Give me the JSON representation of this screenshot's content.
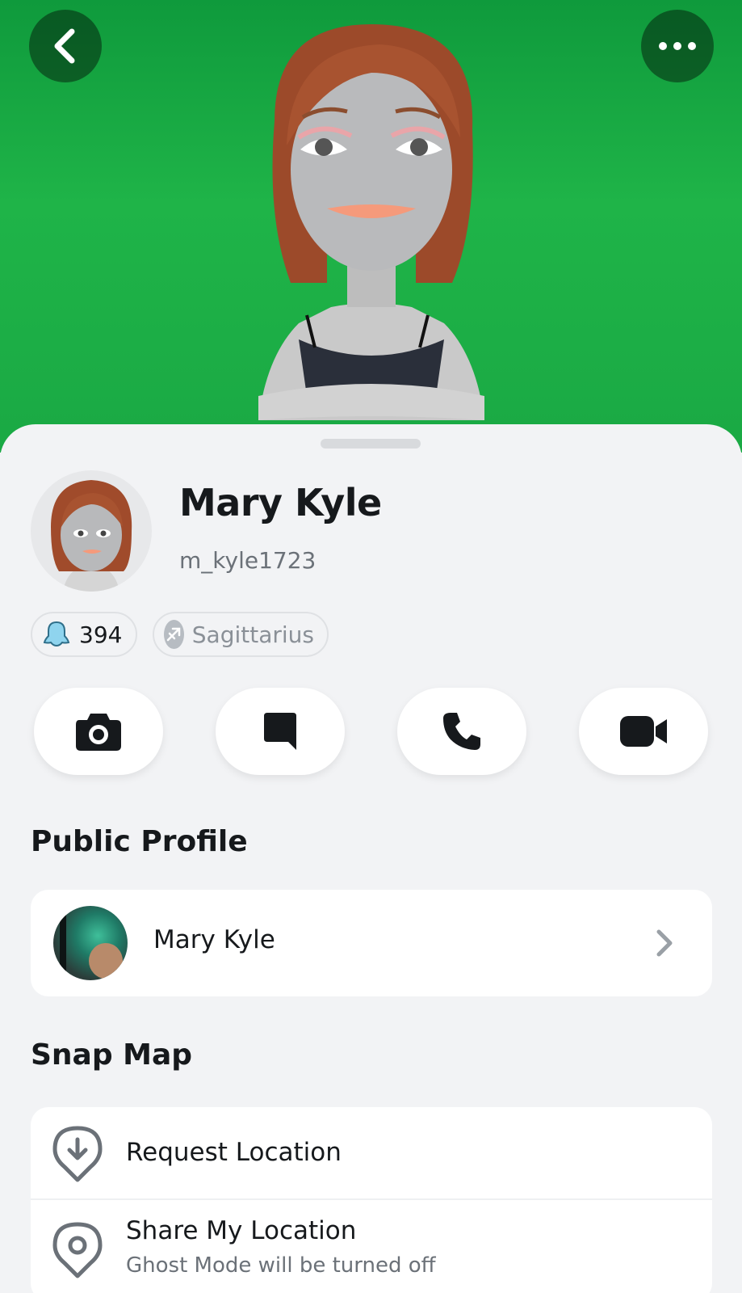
{
  "header": {
    "back_icon": "chevron-left-icon",
    "more_icon": "ellipsis-icon",
    "background_color": "#1fb448"
  },
  "profile": {
    "display_name": "Mary Kyle",
    "username": "m_kyle1723",
    "snap_score": "394",
    "zodiac": "Sagittarius"
  },
  "actions": [
    {
      "icon": "camera-icon"
    },
    {
      "icon": "chat-icon"
    },
    {
      "icon": "phone-icon"
    },
    {
      "icon": "video-icon"
    }
  ],
  "public_profile": {
    "section_title": "Public Profile",
    "name": "Mary Kyle"
  },
  "snap_map": {
    "section_title": "Snap Map",
    "rows": [
      {
        "title": "Request Location",
        "icon": "location-request-icon"
      },
      {
        "title": "Share My Location",
        "subtitle": "Ghost Mode will be turned off",
        "icon": "location-pin-icon"
      }
    ]
  }
}
